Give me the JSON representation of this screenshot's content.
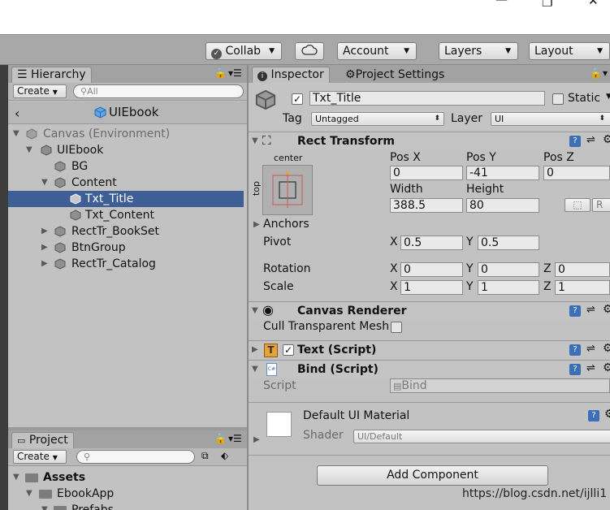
{
  "window": {
    "minimize_icon": "minimize-icon",
    "restore_icon": "restore-icon",
    "close_icon": "close-icon"
  },
  "toolbar": {
    "collab": "Collab",
    "account": "Account",
    "layers": "Layers",
    "layout": "Layout"
  },
  "hierarchy": {
    "tab_label": "Hierarchy",
    "create_label": "Create",
    "search_placeholder": "All",
    "scene_title": "UIEbook",
    "rows": [
      {
        "label": "Canvas (Environment)"
      },
      {
        "label": "UIEbook"
      },
      {
        "label": "BG"
      },
      {
        "label": "Content"
      },
      {
        "label": "Txt_Title"
      },
      {
        "label": "Txt_Content"
      },
      {
        "label": "RectTr_BookSet"
      },
      {
        "label": "BtnGroup"
      },
      {
        "label": "RectTr_Catalog"
      }
    ]
  },
  "project": {
    "tab_label": "Project",
    "create_label": "Create",
    "tree": [
      {
        "label": "Assets"
      },
      {
        "label": "EbookApp"
      },
      {
        "label": "Prefabs"
      }
    ]
  },
  "inspector": {
    "tab_label": "Inspector",
    "settings_tab_label": "Project Settings",
    "object_name": "Txt_Title",
    "static_label": "Static",
    "tag_label": "Tag",
    "tag_value": "Untagged",
    "layer_label": "Layer",
    "layer_value": "UI",
    "rect_transform": {
      "title": "Rect Transform",
      "anchor_h": "center",
      "anchor_v": "top",
      "pos_x_label": "Pos X",
      "pos_y_label": "Pos Y",
      "pos_z_label": "Pos Z",
      "pos_x": "0",
      "pos_y": "-41",
      "pos_z": "0",
      "width_label": "Width",
      "height_label": "Height",
      "width": "388.5",
      "height": "80",
      "r_button": "R",
      "anchors_label": "Anchors",
      "pivot_label": "Pivot",
      "pivot_x": "0.5",
      "pivot_y": "0.5",
      "rotation_label": "Rotation",
      "rot_x": "0",
      "rot_y": "0",
      "rot_z": "0",
      "scale_label": "Scale",
      "scale_x": "1",
      "scale_y": "1",
      "scale_z": "1",
      "x": "X",
      "y": "Y",
      "z": "Z"
    },
    "canvas_renderer": {
      "title": "Canvas Renderer",
      "cull_label": "Cull Transparent Mesh"
    },
    "text_script": {
      "title": "Text (Script)"
    },
    "bind_script": {
      "title": "Bind (Script)",
      "script_label": "Script",
      "script_value": "Bind"
    },
    "material": {
      "name": "Default UI Material",
      "shader_label": "Shader",
      "shader_value": "UI/Default"
    },
    "add_component": "Add Component"
  },
  "watermark": "https://blog.csdn.net/ijlli1"
}
